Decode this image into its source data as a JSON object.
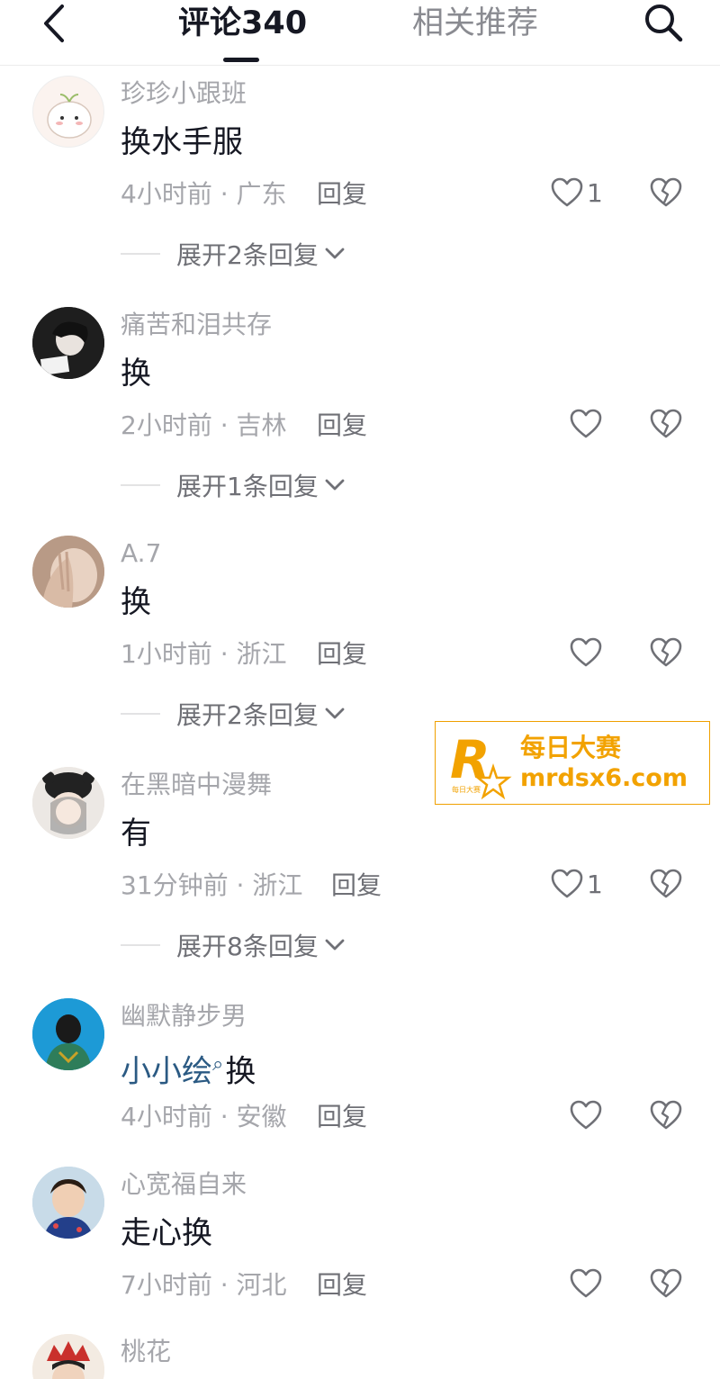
{
  "header": {
    "tabs": [
      {
        "label": "评论340",
        "active": true
      },
      {
        "label": "相关推荐",
        "active": false
      }
    ],
    "back_icon": "chevron-left-icon",
    "search_icon": "search-icon"
  },
  "comments": [
    {
      "username": "珍珍小跟班",
      "content": "换水手服",
      "meta": "4小时前 · 广东",
      "reply": "回复",
      "likes": "1",
      "expand": "展开2条回复"
    },
    {
      "username": "痛苦和泪共存",
      "content": "换",
      "meta": "2小时前 · 吉林",
      "reply": "回复",
      "likes": "",
      "expand": "展开1条回复"
    },
    {
      "username": "A.7",
      "content": "换",
      "meta": "1小时前 · 浙江",
      "reply": "回复",
      "likes": "",
      "expand": "展开2条回复"
    },
    {
      "username": "在黑暗中漫舞",
      "content": "有",
      "meta": "31分钟前 · 浙江",
      "reply": "回复",
      "likes": "1",
      "expand": "展开8条回复"
    },
    {
      "username": "幽默静步男",
      "mention": "小小绘",
      "content": "换",
      "meta": "4小时前 · 安徽",
      "reply": "回复",
      "likes": ""
    },
    {
      "username": "心宽福自来",
      "content": "走心换",
      "meta": "7小时前 · 河北",
      "reply": "回复",
      "likes": ""
    },
    {
      "username": "桃花"
    }
  ],
  "watermark": {
    "logo_letter": "R",
    "logo_small": "每日大赛",
    "title": "每日大赛",
    "url": "mrdsx6.com"
  },
  "colors": {
    "text_primary": "#161823",
    "text_secondary": "#a5a6ab",
    "mention": "#2b5a83",
    "watermark": "#f2a200"
  }
}
